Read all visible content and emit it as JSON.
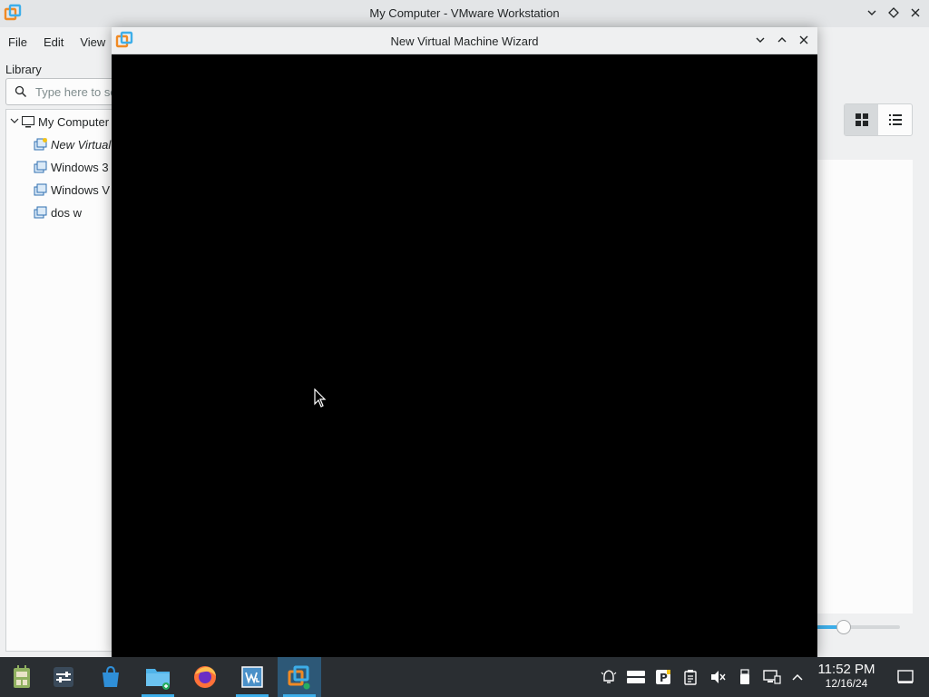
{
  "main_window": {
    "title": "My Computer - VMware Workstation",
    "menu": [
      "File",
      "Edit",
      "View"
    ],
    "library_label": "Library",
    "search_placeholder": "Type here to search",
    "tree": {
      "root": "My Computer",
      "items": [
        "New Virtual Machine",
        "Windows 3",
        "Windows V",
        "dos w"
      ]
    }
  },
  "wizard": {
    "title": "New Virtual Machine Wizard"
  },
  "taskbar": {
    "apps": [
      "application-launcher",
      "system-settings",
      "discover-store",
      "dolphin-file-manager",
      "firefox",
      "vmware-workstation",
      "vmware-player"
    ],
    "clock": {
      "time": "11:52 PM",
      "date": "12/16/24"
    }
  },
  "colors": {
    "accent": "#3daee9",
    "taskbar": "#2a2e32",
    "wizard_body": "#000000",
    "vmware_orange": "#f08a24"
  }
}
